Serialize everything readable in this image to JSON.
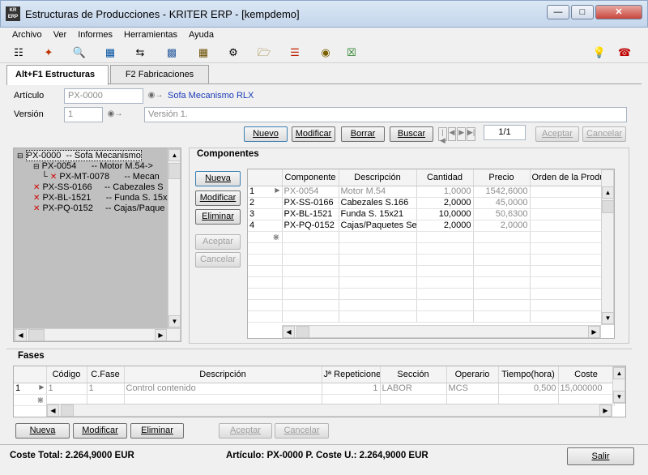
{
  "window": {
    "title": "Estructuras de Producciones - KRITER ERP - [kempdemo]",
    "icon_text": "KR ERP"
  },
  "menu": [
    "Archivo",
    "Ver",
    "Informes",
    "Herramientas",
    "Ayuda"
  ],
  "toolbar_icons": [
    "tree-structure-icon",
    "magic-wand-icon",
    "print-preview-icon",
    "search-window-icon",
    "split-arrows-icon",
    "document-stack-icon",
    "calculator-icon",
    "gears-icon",
    "export-folder-icon",
    "hierarchy-icon",
    "money-bag-icon",
    "excel-icon",
    "tips-bulb-icon",
    "alarm-icon"
  ],
  "tabs": [
    "Alt+F1 Estructuras",
    "F2 Fabricaciones"
  ],
  "header": {
    "articulo_label": "Artículo",
    "articulo_value": "PX-0000",
    "articulo_desc": "Sofa Mecanismo RLX",
    "version_label": "Versión",
    "version_value": "1",
    "version_desc": "Versión 1."
  },
  "nav_buttons": {
    "nuevo": "Nuevo",
    "modificar": "Modificar",
    "borrar": "Borrar",
    "buscar": "Buscar",
    "record": "1/1",
    "aceptar": "Aceptar",
    "cancelar": "Cancelar"
  },
  "tree": [
    {
      "code": "PX-0000",
      "desc": "-- Sofa Mecanismo"
    },
    {
      "code": "PX-0054",
      "desc": "-- Motor M.54->"
    },
    {
      "code": "PX-MT-0078",
      "desc": "-- Mecan"
    },
    {
      "code": "PX-SS-0166",
      "desc": "-- Cabezales S"
    },
    {
      "code": "PX-BL-1521",
      "desc": "-- Funda S. 15x"
    },
    {
      "code": "PX-PQ-0152",
      "desc": "-- Cajas/Paque"
    }
  ],
  "componentes": {
    "title": "Componentes",
    "buttons": {
      "nueva": "Nueva",
      "modificar": "Modificar",
      "eliminar": "Eliminar",
      "aceptar": "Aceptar",
      "cancelar": "Cancelar"
    },
    "columns": [
      "Componente",
      "Descripción",
      "Cantidad",
      "Precio",
      "Orden de la Produ"
    ],
    "rows": [
      {
        "n": "1",
        "componente": "PX-0054",
        "descripcion": "Motor M.54",
        "cantidad": "1,0000",
        "precio": "1542,6000"
      },
      {
        "n": "2",
        "componente": "PX-SS-0166",
        "descripcion": "Cabezales S.166",
        "cantidad": "2,0000",
        "precio": "45,0000"
      },
      {
        "n": "3",
        "componente": "PX-BL-1521",
        "descripcion": "Funda S. 15x21",
        "cantidad": "10,0000",
        "precio": "50,6300"
      },
      {
        "n": "4",
        "componente": "PX-PQ-0152",
        "descripcion": "Cajas/Paquetes Se",
        "cantidad": "2,0000",
        "precio": "2,0000"
      }
    ]
  },
  "fases": {
    "title": "Fases",
    "columns": [
      "Código",
      "C.Fase",
      "Descripción",
      "Jª Repeticione",
      "Sección",
      "Operario",
      "Tiempo(hora)",
      "Coste"
    ],
    "rows": [
      {
        "n": "1",
        "codigo": "1",
        "cfase": "1",
        "descripcion": "Control contenido",
        "repeticion": "1",
        "seccion": "LABOR",
        "operario": "MCS",
        "tiempo": "0,500",
        "coste": "15,000000"
      }
    ],
    "buttons": {
      "nueva": "Nueva",
      "modificar": "Modificar",
      "eliminar": "Eliminar",
      "aceptar": "Aceptar",
      "cancelar": "Cancelar"
    }
  },
  "status": {
    "coste_total": "Coste Total: 2.264,9000 EUR",
    "articulo_info": "Artículo: PX-0000 P. Coste U.: 2.264,9000 EUR",
    "salir": "Salir"
  },
  "colors": {
    "link": "#1a3cb8",
    "title_bar": "#c9daef",
    "close_button": "#c8463d"
  }
}
